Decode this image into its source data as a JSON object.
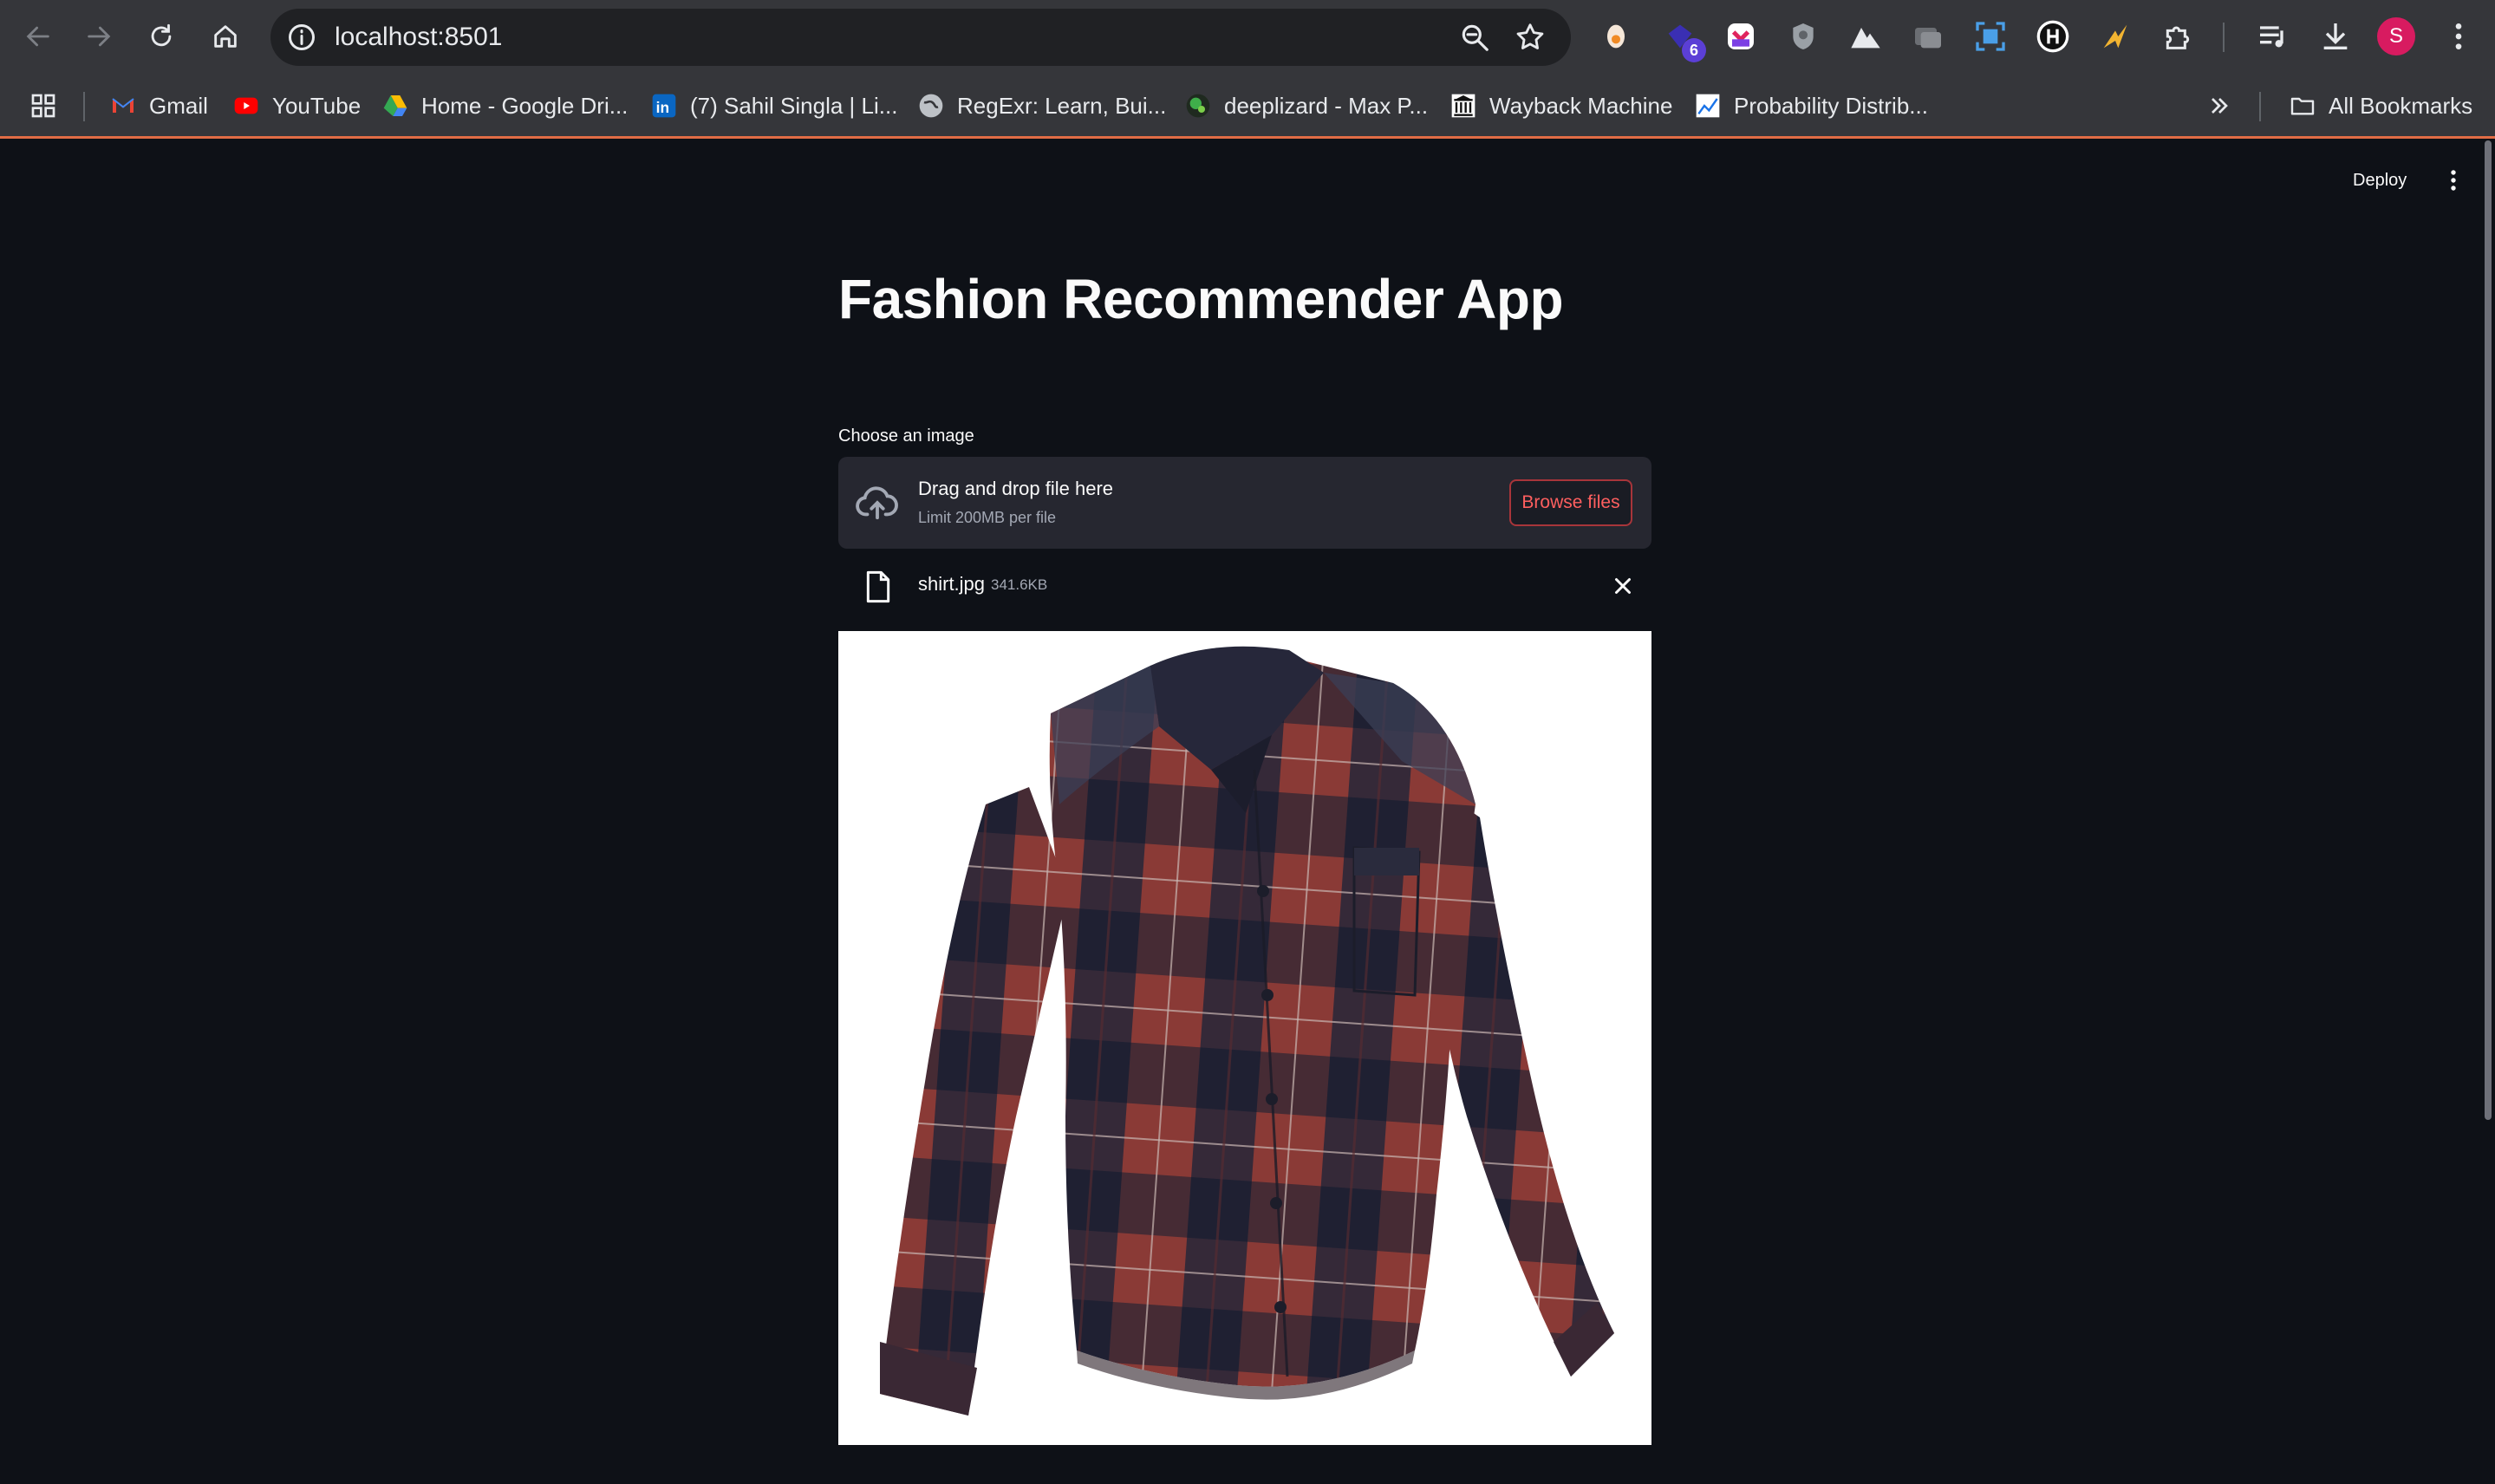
{
  "browser": {
    "url": "localhost:8501",
    "extension_badge": "6",
    "profile_initial": "S",
    "bookmarks": [
      {
        "label": "Gmail",
        "icon": "gmail-icon"
      },
      {
        "label": "YouTube",
        "icon": "youtube-icon"
      },
      {
        "label": "Home - Google Dri...",
        "icon": "google-drive-icon"
      },
      {
        "label": "(7) Sahil Singla | Li...",
        "icon": "linkedin-icon"
      },
      {
        "label": "RegExr: Learn, Bui...",
        "icon": "globe-icon"
      },
      {
        "label": "deeplizard - Max P...",
        "icon": "deeplizard-icon"
      },
      {
        "label": "Wayback Machine",
        "icon": "wayback-machine-icon"
      },
      {
        "label": "Probability Distrib...",
        "icon": "chart-icon"
      }
    ],
    "all_bookmarks": "All Bookmarks"
  },
  "app": {
    "deploy_label": "Deploy",
    "title": "Fashion Recommender App",
    "uploader": {
      "label": "Choose an image",
      "drop_text": "Drag and drop file here",
      "limit_text": "Limit 200MB per file",
      "browse_label": "Browse files"
    },
    "file": {
      "name": "shirt.jpg",
      "size": "341.6KB"
    },
    "image_description_icon": "plaid-shirt-image"
  },
  "colors": {
    "page_bg": "#0e1117",
    "dropzone_bg": "#262730",
    "accent": "#ff4b4b",
    "chrome_bg": "#35363a",
    "shirt_red": "#8a3a36",
    "shirt_navy": "#23253a"
  }
}
